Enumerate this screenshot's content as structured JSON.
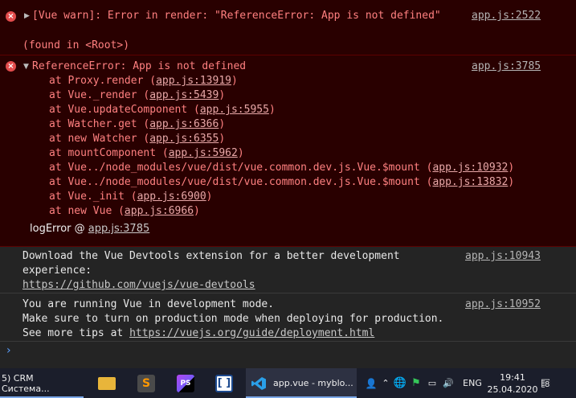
{
  "console": {
    "warn": {
      "text": "[Vue warn]: Error in render: \"ReferenceError: App is not defined\"",
      "source": "app.js:2522",
      "found": "(found in <Root>)"
    },
    "error": {
      "title": "ReferenceError: App is not defined",
      "source": "app.js:3785",
      "stack": [
        {
          "fn": "at Proxy.render (",
          "link": "app.js:13919",
          "end": ")"
        },
        {
          "fn": "at Vue._render (",
          "link": "app.js:5439",
          "end": ")"
        },
        {
          "fn": "at Vue.updateComponent (",
          "link": "app.js:5955",
          "end": ")"
        },
        {
          "fn": "at Watcher.get (",
          "link": "app.js:6366",
          "end": ")"
        },
        {
          "fn": "at new Watcher (",
          "link": "app.js:6355",
          "end": ")"
        },
        {
          "fn": "at mountComponent (",
          "link": "app.js:5962",
          "end": ")"
        },
        {
          "fn": "at Vue../node_modules/vue/dist/vue.common.dev.js.Vue.$mount (",
          "link": "app.js:10932",
          "end": ")"
        },
        {
          "fn": "at Vue../node_modules/vue/dist/vue.common.dev.js.Vue.$mount (",
          "link": "app.js:13832",
          "end": ")"
        },
        {
          "fn": "at Vue._init (",
          "link": "app.js:6900",
          "end": ")"
        },
        {
          "fn": "at new Vue (",
          "link": "app.js:6966",
          "end": ")"
        }
      ],
      "logerror_label": "logError",
      "logerror_at": "@",
      "logerror_link": "app.js:3785"
    },
    "devtools": {
      "line1": "Download the Vue Devtools extension for a better development",
      "line2": "experience:",
      "link": "https://github.com/vuejs/vue-devtools",
      "source": "app.js:10943"
    },
    "devmode": {
      "line1": "You are running Vue in development mode.",
      "line2": "Make sure to turn on production mode when deploying for production.",
      "line3_prefix": "See more tips at ",
      "link": "https://vuejs.org/guide/deployment.html",
      "source": "app.js:10952"
    },
    "prompt": "›"
  },
  "taskbar": {
    "crm_label": "5) CRM Система...",
    "phpstorm_icon": "PS",
    "vscode_label": "app.vue - myblo...",
    "lang": "ENG",
    "time": "19:41",
    "date": "25.04.2020",
    "notif_count": "8"
  }
}
